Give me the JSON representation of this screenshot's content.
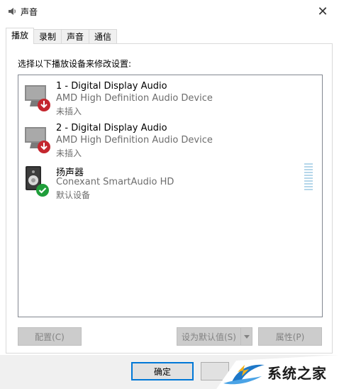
{
  "window": {
    "title": "声音",
    "close_glyph": "✕"
  },
  "tabs": [
    {
      "label": "播放",
      "active": true
    },
    {
      "label": "录制",
      "active": false
    },
    {
      "label": "声音",
      "active": false
    },
    {
      "label": "通信",
      "active": false
    }
  ],
  "panel": {
    "instruction": "选择以下播放设备来修改设置:"
  },
  "devices": [
    {
      "name": "1 - Digital Display Audio",
      "description": "AMD High Definition Audio Device",
      "status": "未插入",
      "icon": "monitor-unplugged-icon"
    },
    {
      "name": "2 - Digital Display Audio",
      "description": "AMD High Definition Audio Device",
      "status": "未插入",
      "icon": "monitor-unplugged-icon"
    },
    {
      "name": "扬声器",
      "description": "Conexant SmartAudio HD",
      "status": "默认设备",
      "icon": "speaker-default-icon"
    }
  ],
  "buttons": {
    "configure": "配置(C)",
    "set_default": "设为默认值(S)",
    "properties": "属性(P)",
    "ok": "确定"
  },
  "watermark": {
    "text": "系统之家"
  },
  "colors": {
    "accent": "#0078d7",
    "unplugged_badge": "#c4262e",
    "default_badge": "#1f9e3a",
    "meter": "#b6d7ea"
  }
}
